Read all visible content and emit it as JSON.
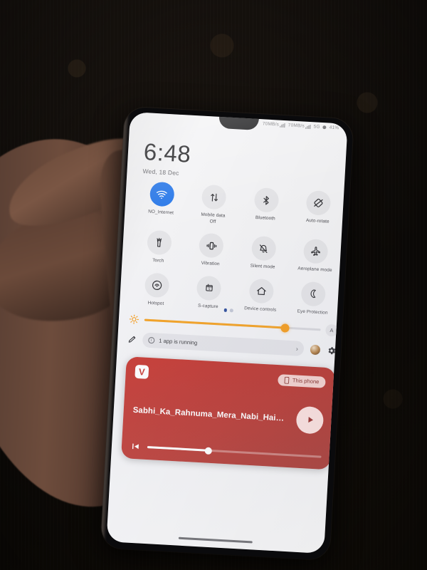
{
  "scene": {
    "description": "Hand holding a smartphone showing the quick settings shade",
    "background": "dark patterned carpet"
  },
  "statusbar": {
    "items": [
      "70MB/s",
      "70MB/s",
      "5G",
      "41%"
    ],
    "network_label": "5G",
    "battery_label": "41%"
  },
  "header": {
    "time": "6:48",
    "date": "Wed, 18 Dec"
  },
  "tiles": [
    {
      "label": "NO_Internet",
      "sub": "",
      "icon": "wifi-icon",
      "state": "on"
    },
    {
      "label": "Mobile data",
      "sub": "Off",
      "icon": "mobile-data-icon",
      "state": "off"
    },
    {
      "label": "Bluetooth",
      "sub": "",
      "icon": "bluetooth-icon",
      "state": "off"
    },
    {
      "label": "Auto-rotate",
      "sub": "",
      "icon": "auto-rotate-icon",
      "state": "off"
    },
    {
      "label": "Torch",
      "sub": "",
      "icon": "torch-icon",
      "state": "off"
    },
    {
      "label": "Vibration",
      "sub": "",
      "icon": "vibration-icon",
      "state": "off"
    },
    {
      "label": "Silent mode",
      "sub": "",
      "icon": "silent-mode-icon",
      "state": "off"
    },
    {
      "label": "Aeroplane mode",
      "sub": "",
      "icon": "aeroplane-icon",
      "state": "off"
    },
    {
      "label": "Hotspot",
      "sub": "",
      "icon": "hotspot-icon",
      "state": "off"
    },
    {
      "label": "S-capture",
      "sub": "",
      "icon": "s-capture-icon",
      "state": "off"
    },
    {
      "label": "Device controls",
      "sub": "",
      "icon": "home-icon",
      "state": "off"
    },
    {
      "label": "Eye Protection",
      "sub": "",
      "icon": "moon-icon",
      "state": "off"
    }
  ],
  "pager": {
    "pages": 2,
    "active": 1
  },
  "brightness": {
    "icon": "brightness-sun-icon",
    "value_percent": 80,
    "auto_label": "A"
  },
  "runbar": {
    "running_text": "1 app is running",
    "info_glyph": "i",
    "chevron": "›",
    "edit_icon": "pencil-icon",
    "avatar_icon": "user-avatar",
    "settings_icon": "gear-icon"
  },
  "media": {
    "app_icon_letter": "V",
    "app_icon_name": "vlc-app-icon",
    "cast_label": "This phone",
    "cast_icon": "phone-icon",
    "track_title": "Sabhi_Ka_Rahnuma_Mera_Nabi_Hai…",
    "play_icon": "play-icon",
    "previous_icon": "previous-track-icon",
    "progress_percent": 35,
    "accent_color": "#c7342c",
    "chip_color": "#f4cfcb"
  },
  "navbar": {
    "label": "gesture-nav-bar"
  },
  "colors": {
    "screen_bg": "#f2f2f4",
    "tile_bg": "#e4e4e7",
    "tile_active": "#1f72e8",
    "brightness_accent": "#f59a17",
    "media_red": "#c7342c"
  }
}
